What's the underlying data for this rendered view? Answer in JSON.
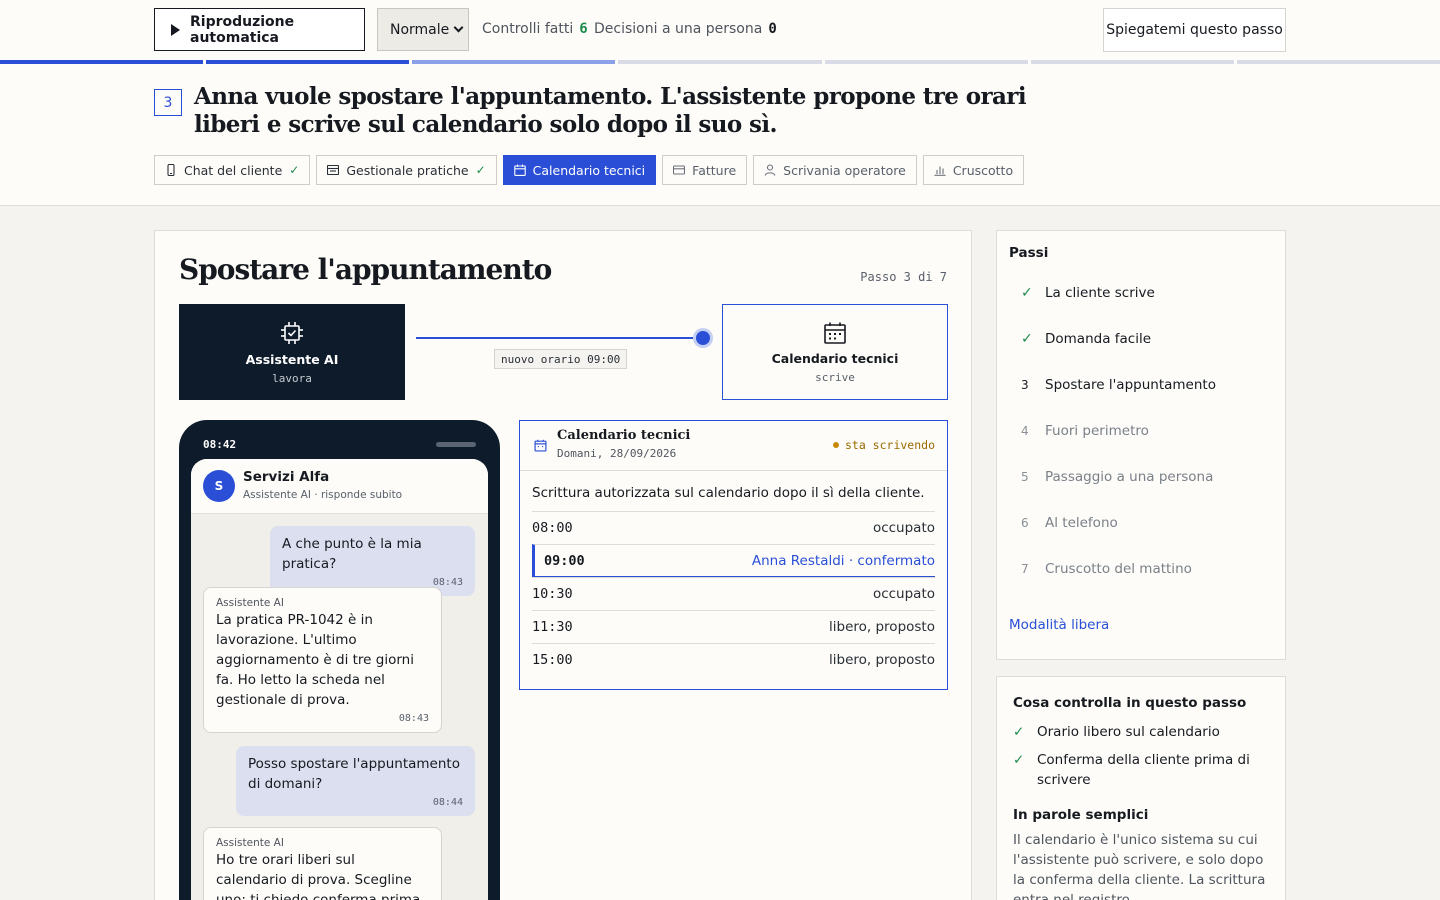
{
  "topbar": {
    "autoplay_label": "Riproduzione automatica",
    "speed_value": "Normale",
    "checks_label": "Controlli fatti",
    "checks_count": "6",
    "decisions_label": "Decisioni a una persona",
    "decisions_count": "0",
    "explain_label": "Spiegatemi questo passo"
  },
  "progress": {
    "total_segments": 7,
    "completed": 2,
    "current": 3
  },
  "step": {
    "number": "3",
    "title": "Anna vuole spostare l'appuntamento. L'assistente propone tre orari liberi e scrive sul calendario solo dopo il suo sì."
  },
  "tabs": [
    {
      "label": "Chat del cliente",
      "icon": "phone-icon",
      "checked": true
    },
    {
      "label": "Gestionale pratiche",
      "icon": "records-icon",
      "checked": true
    },
    {
      "label": "Calendario tecnici",
      "icon": "calendar-icon",
      "active": true
    },
    {
      "label": "Fatture",
      "icon": "card-icon"
    },
    {
      "label": "Scrivania operatore",
      "icon": "person-icon"
    },
    {
      "label": "Cruscotto",
      "icon": "bar-chart-icon"
    }
  ],
  "panel": {
    "title": "Spostare l'appuntamento",
    "step_counter": "Passo 3 di 7",
    "flow": {
      "from_name": "Assistente AI",
      "from_role": "lavora",
      "label": "nuovo orario 09:00",
      "to_name": "Calendario tecnici",
      "to_role": "scrive"
    }
  },
  "phone": {
    "time": "08:42",
    "contact_initial": "S",
    "contact_name": "Servizi Alfa",
    "contact_sub": "Assistente AI · risponde subito",
    "messages": [
      {
        "from": "user",
        "text": "A che punto è la mia pratica?",
        "time": "08:43"
      },
      {
        "from": "bot",
        "sender": "Assistente AI",
        "text": "La pratica PR-1042 è in lavorazione. L'ultimo aggiornamento è di tre giorni fa. Ho letto la scheda nel gestionale di prova.",
        "time": "08:43"
      },
      {
        "from": "user",
        "text": "Posso spostare l'appuntamento di domani?",
        "time": "08:44"
      },
      {
        "from": "bot",
        "sender": "Assistente AI",
        "text": "Ho tre orari liberi sul calendario di prova. Scegline uno: ti chiedo conferma prima di scrivere."
      }
    ]
  },
  "calendar": {
    "title": "Calendario tecnici",
    "date": "Domani, 28/09/2026",
    "status": "sta scrivendo",
    "note": "Scrittura autorizzata sul calendario dopo il sì della cliente.",
    "rows": [
      {
        "time": "08:00",
        "state": "occupato"
      },
      {
        "time": "09:00",
        "state": "Anna Restaldi · confermato",
        "selected": true
      },
      {
        "time": "10:30",
        "state": "occupato"
      },
      {
        "time": "11:30",
        "state": "libero, proposto"
      },
      {
        "time": "15:00",
        "state": "libero, proposto"
      }
    ]
  },
  "sidebar": {
    "steps_heading": "Passi",
    "steps": [
      {
        "marker": "✓",
        "label": "La cliente scrive",
        "state": "done"
      },
      {
        "marker": "✓",
        "label": "Domanda facile",
        "state": "done"
      },
      {
        "marker": "3",
        "label": "Spostare l'appuntamento",
        "state": "current"
      },
      {
        "marker": "4",
        "label": "Fuori perimetro",
        "state": "todo"
      },
      {
        "marker": "5",
        "label": "Passaggio a una persona",
        "state": "todo"
      },
      {
        "marker": "6",
        "label": "Al telefono",
        "state": "todo"
      },
      {
        "marker": "7",
        "label": "Cruscotto del mattino",
        "state": "todo"
      }
    ],
    "free_mode": "Modalità libera",
    "checks_heading": "Cosa controlla in questo passo",
    "checks": [
      "Orario libero sul calendario",
      "Conferma della cliente prima di scrivere"
    ],
    "simple_heading": "In parole semplici",
    "simple_text": "Il calendario è l'unico sistema su cui l'assistente può scrivere, e solo dopo la conferma della cliente. La scrittura entra nel registro."
  },
  "colors": {
    "accent": "#2a4fd6",
    "success": "#1f8a4c",
    "dark": "#0d1b2a",
    "warning": "#c8880a"
  }
}
